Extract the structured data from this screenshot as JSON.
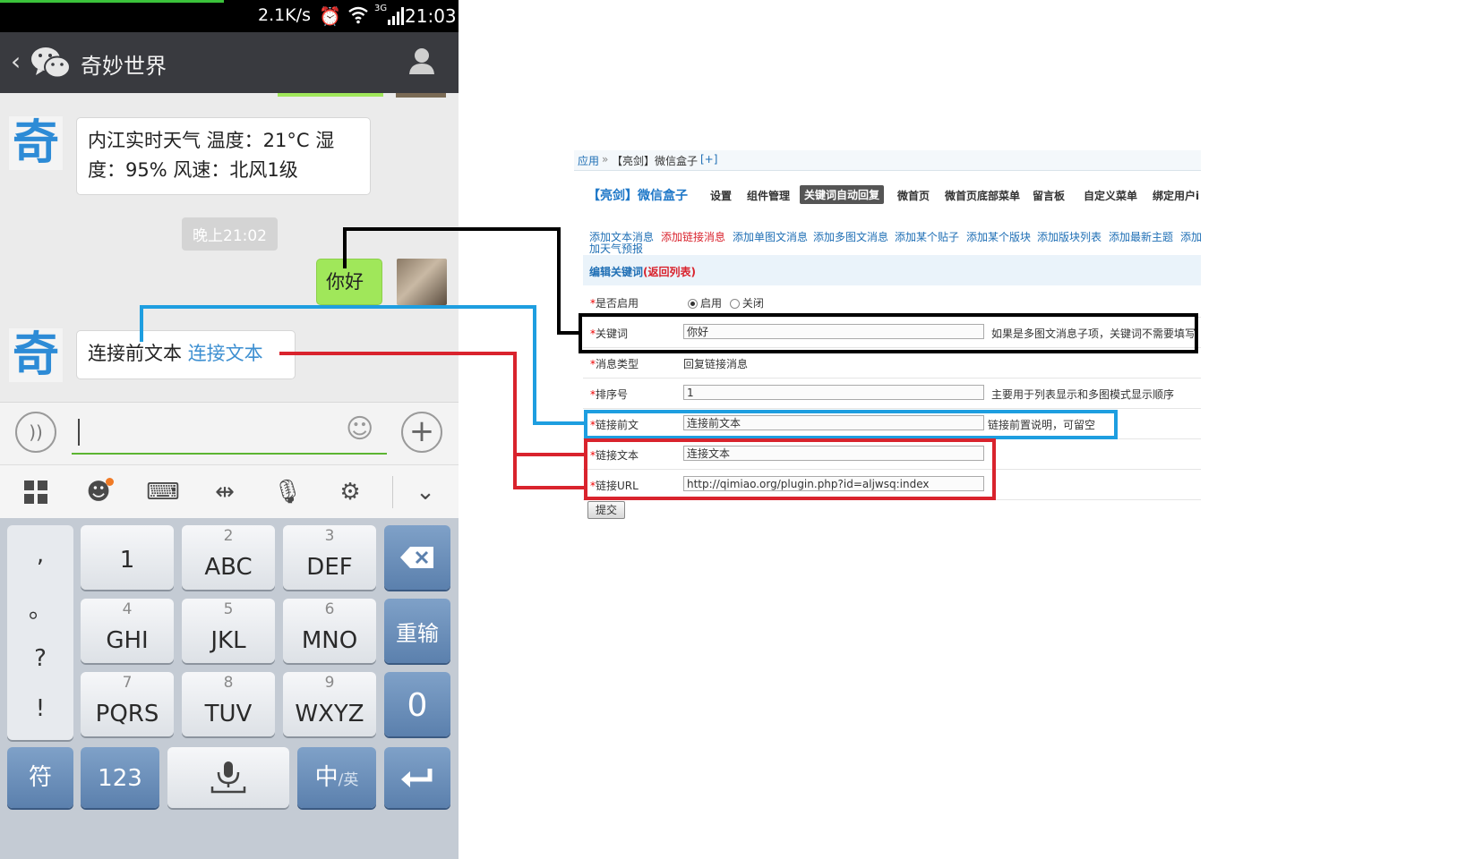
{
  "phone": {
    "status": {
      "speed": "2.1K/s",
      "network": "3G",
      "time": "21:03"
    },
    "title": "奇妙世界",
    "messages": {
      "weather": "内江实时天气 温度：21°C 湿度：95% 风速：北风1级",
      "time_chip": "晚上21:02",
      "sent": "你好",
      "link_prefix": "连接前文本",
      "link_text": "连接文本",
      "avatar_char": "奇"
    },
    "keyboard": {
      "symbols": [
        ",",
        "。",
        "?",
        "!"
      ],
      "keys": [
        {
          "num": "",
          "main": "1"
        },
        {
          "num": "2",
          "main": "ABC"
        },
        {
          "num": "3",
          "main": "DEF"
        },
        {
          "num": "4",
          "main": "GHI"
        },
        {
          "num": "5",
          "main": "JKL"
        },
        {
          "num": "6",
          "main": "MNO"
        },
        {
          "num": "7",
          "main": "PQRS"
        },
        {
          "num": "8",
          "main": "TUV"
        },
        {
          "num": "9",
          "main": "WXYZ"
        }
      ],
      "retype": "重输",
      "zero": "0",
      "fu": "符",
      "num_mode": "123",
      "lang_main": "中",
      "lang_sub": "/英"
    }
  },
  "web": {
    "breadcrumb": {
      "root": "应用",
      "sep": "»",
      "plugin": "【亮剑】微信盒子",
      "add": "[+]"
    },
    "plugin_name": "【亮剑】微信盒子",
    "nav": [
      "设置",
      "组件管理",
      "关键词自动回复",
      "微首页",
      "微首页底部菜单",
      "留言板",
      "自定义菜单",
      "绑定用户i"
    ],
    "sublinks": [
      "添加文本消息",
      "添加链接消息",
      "添加单图文消息",
      "添加多图文消息",
      "添加某个贴子",
      "添加某个版块",
      "添加版块列表",
      "添加最新主题",
      "添加"
    ],
    "sublink2": "加天气预报",
    "section_title": "编辑关键词",
    "section_back": "(返回列表)",
    "form": {
      "enabled_label": "是否启用",
      "enabled_on": "启用",
      "enabled_off": "关闭",
      "keyword_label": "关键词",
      "keyword_value": "你好",
      "keyword_hint": "如果是多图文消息子项，关键词不需要填写",
      "type_label": "消息类型",
      "type_value": "回复链接消息",
      "order_label": "排序号",
      "order_value": "1",
      "order_hint": "主要用于列表显示和多图模式显示顺序",
      "prefix_label": "链接前文",
      "prefix_value": "连接前文本",
      "prefix_hint": "链接前置说明，可留空",
      "linktext_label": "链接文本",
      "linktext_value": "连接文本",
      "url_label": "链接URL",
      "url_value": "http://qimiao.org/plugin.php?id=aljwsq:index",
      "submit": "提交",
      "required_mark": "*"
    }
  },
  "colors": {
    "black_line": "#000000",
    "blue_line": "#1e9ee0",
    "red_line": "#d9232d",
    "link_blue": "#3d8fd1"
  }
}
